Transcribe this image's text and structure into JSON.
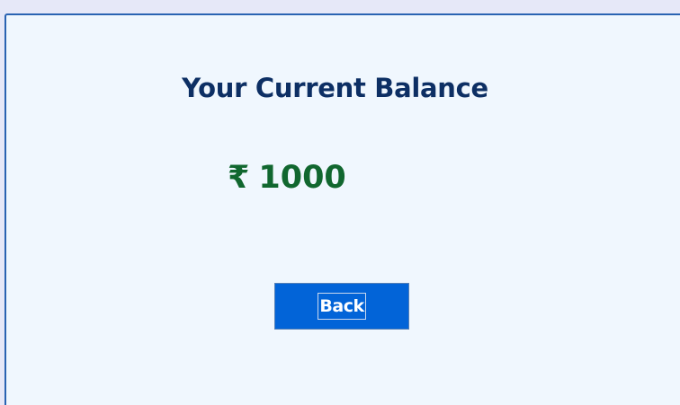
{
  "balance": {
    "title": "Your Current Balance",
    "currency_symbol": "₹",
    "amount": "1000"
  },
  "actions": {
    "back_label": "Back"
  },
  "colors": {
    "title": "#0d2f64",
    "amount": "#11672f",
    "button": "#0264d8",
    "panel_background": "#f0f7fe",
    "panel_border": "#2a63b2",
    "page_background": "#e6e8f8"
  }
}
